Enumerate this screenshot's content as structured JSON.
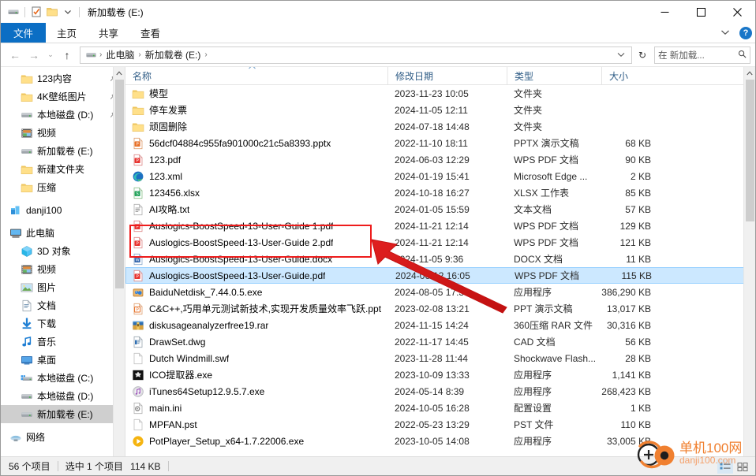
{
  "window": {
    "title": "新加载卷 (E:)",
    "quick_access": [
      {
        "name": "drive-icon",
        "glyph": "drive"
      },
      {
        "name": "properties-checkbox-icon",
        "glyph": "check"
      },
      {
        "name": "new-folder-icon",
        "glyph": "folder"
      },
      {
        "name": "customize-qat-chevron-icon",
        "glyph": "chevron-down"
      }
    ],
    "controls": {
      "minimize": "─",
      "maximize": "□",
      "close": "✕"
    }
  },
  "ribbon": {
    "tabs": [
      {
        "label": "文件",
        "active": true
      },
      {
        "label": "主页",
        "active": false
      },
      {
        "label": "共享",
        "active": false
      },
      {
        "label": "查看",
        "active": false
      }
    ],
    "collapse_chevron": "⌄",
    "help_label": "?"
  },
  "address": {
    "back": "←",
    "forward": "→",
    "recent": "⌄",
    "up": "↑",
    "crumbs": [
      "此电脑",
      "新加载卷 (E:)"
    ],
    "separator": "›",
    "refresh": "↻",
    "search_value": "在 新加载...",
    "search_placeholder": "在 新加载卷 (E:) 中搜索",
    "search_icon": "⌕"
  },
  "nav_pane": {
    "items": [
      {
        "label": "123内容",
        "icon": "folder",
        "indent": 1,
        "pinned": true,
        "selected": false
      },
      {
        "label": "4K壁纸图片",
        "icon": "folder",
        "indent": 1,
        "pinned": true,
        "selected": false
      },
      {
        "label": "本地磁盘 (D:)",
        "icon": "drive",
        "indent": 1,
        "pinned": true,
        "selected": false
      },
      {
        "label": "视频",
        "icon": "video",
        "indent": 1,
        "pinned": false,
        "selected": false
      },
      {
        "label": "新加载卷 (E:)",
        "icon": "drive",
        "indent": 1,
        "pinned": false,
        "selected": false
      },
      {
        "label": "新建文件夹",
        "icon": "folder",
        "indent": 1,
        "pinned": false,
        "selected": false
      },
      {
        "label": "压缩",
        "icon": "folder",
        "indent": 1,
        "pinned": false,
        "selected": false
      },
      {
        "label": "danji100",
        "icon": "onedrive",
        "indent": 0,
        "pinned": false,
        "selected": false,
        "gap_before": true
      },
      {
        "label": "此电脑",
        "icon": "pc",
        "indent": 0,
        "pinned": false,
        "selected": false,
        "gap_before": true
      },
      {
        "label": "3D 对象",
        "icon": "3d",
        "indent": 1,
        "pinned": false,
        "selected": false
      },
      {
        "label": "视频",
        "icon": "video",
        "indent": 1,
        "pinned": false,
        "selected": false
      },
      {
        "label": "图片",
        "icon": "pictures",
        "indent": 1,
        "pinned": false,
        "selected": false
      },
      {
        "label": "文档",
        "icon": "documents",
        "indent": 1,
        "pinned": false,
        "selected": false
      },
      {
        "label": "下载",
        "icon": "downloads",
        "indent": 1,
        "pinned": false,
        "selected": false
      },
      {
        "label": "音乐",
        "icon": "music",
        "indent": 1,
        "pinned": false,
        "selected": false
      },
      {
        "label": "桌面",
        "icon": "desktop",
        "indent": 1,
        "pinned": false,
        "selected": false
      },
      {
        "label": "本地磁盘 (C:)",
        "icon": "sysdrive",
        "indent": 1,
        "pinned": false,
        "selected": false
      },
      {
        "label": "本地磁盘 (D:)",
        "icon": "drive",
        "indent": 1,
        "pinned": false,
        "selected": false
      },
      {
        "label": "新加载卷 (E:)",
        "icon": "drive",
        "indent": 1,
        "pinned": false,
        "selected": true
      },
      {
        "label": "网络",
        "icon": "network",
        "indent": 0,
        "pinned": false,
        "selected": false,
        "gap_before": true
      }
    ]
  },
  "columns": [
    {
      "key": "name",
      "label": "名称",
      "sorted": "asc"
    },
    {
      "key": "date",
      "label": "修改日期",
      "sorted": ""
    },
    {
      "key": "type",
      "label": "类型",
      "sorted": ""
    },
    {
      "key": "size",
      "label": "大小",
      "sorted": ""
    }
  ],
  "files": [
    {
      "name": "模型",
      "date": "2023-11-23 10:05",
      "type": "文件夹",
      "size": "",
      "icon": "folder",
      "selected": false
    },
    {
      "name": "停车发票",
      "date": "2024-11-05 12:11",
      "type": "文件夹",
      "size": "",
      "icon": "folder",
      "selected": false
    },
    {
      "name": "顽固删除",
      "date": "2024-07-18 14:48",
      "type": "文件夹",
      "size": "",
      "icon": "folder",
      "selected": false
    },
    {
      "name": "56dcf04884c955fa901000c21c5a8393.pptx",
      "date": "2022-11-10 18:11",
      "type": "PPTX 演示文稿",
      "size": "68 KB",
      "icon": "pptx",
      "selected": false
    },
    {
      "name": "123.pdf",
      "date": "2024-06-03 12:29",
      "type": "WPS PDF 文档",
      "size": "90 KB",
      "icon": "pdf",
      "selected": false
    },
    {
      "name": "123.xml",
      "date": "2024-01-19 15:41",
      "type": "Microsoft Edge ...",
      "size": "2 KB",
      "icon": "edge",
      "selected": false
    },
    {
      "name": "123456.xlsx",
      "date": "2024-10-18 16:27",
      "type": "XLSX 工作表",
      "size": "85 KB",
      "icon": "xlsx",
      "selected": false
    },
    {
      "name": "AI攻略.txt",
      "date": "2024-01-05 15:59",
      "type": "文本文档",
      "size": "57 KB",
      "icon": "txt",
      "selected": false
    },
    {
      "name": "Auslogics-BoostSpeed-13-User-Guide 1.pdf",
      "date": "2024-11-21 12:14",
      "type": "WPS PDF 文档",
      "size": "129 KB",
      "icon": "pdf",
      "selected": false
    },
    {
      "name": "Auslogics-BoostSpeed-13-User-Guide 2.pdf",
      "date": "2024-11-21 12:14",
      "type": "WPS PDF 文档",
      "size": "121 KB",
      "icon": "pdf",
      "selected": false
    },
    {
      "name": "Auslogics-BoostSpeed-13-User-Guide.docx",
      "date": "2024-11-05 9:36",
      "type": "DOCX 文档",
      "size": "11 KB",
      "icon": "docx",
      "selected": false
    },
    {
      "name": "Auslogics-BoostSpeed-13-User-Guide.pdf",
      "date": "2024-06-12 16:05",
      "type": "WPS PDF 文档",
      "size": "115 KB",
      "icon": "pdf",
      "selected": true
    },
    {
      "name": "BaiduNetdisk_7.44.0.5.exe",
      "date": "2024-08-05 17:38",
      "type": "应用程序",
      "size": "386,290 KB",
      "icon": "baidu",
      "selected": false
    },
    {
      "name": "C&C++,巧用单元测试新技术,实现开发质量效率飞跃.ppt",
      "date": "2023-02-08 13:21",
      "type": "PPT 演示文稿",
      "size": "13,017 KB",
      "icon": "ppt",
      "selected": false
    },
    {
      "name": "diskusageanalyzerfree19.rar",
      "date": "2024-11-15 14:24",
      "type": "360压缩 RAR 文件",
      "size": "30,316 KB",
      "icon": "rar",
      "selected": false
    },
    {
      "name": "DrawSet.dwg",
      "date": "2022-11-17 14:45",
      "type": "CAD 文档",
      "size": "56 KB",
      "icon": "dwg",
      "selected": false
    },
    {
      "name": "Dutch Windmill.swf",
      "date": "2023-11-28 11:44",
      "type": "Shockwave Flash...",
      "size": "28 KB",
      "icon": "blank",
      "selected": false
    },
    {
      "name": "ICO提取器.exe",
      "date": "2023-10-09 13:33",
      "type": "应用程序",
      "size": "1,141 KB",
      "icon": "icoexe",
      "selected": false
    },
    {
      "name": "iTunes64Setup12.9.5.7.exe",
      "date": "2024-05-14 8:39",
      "type": "应用程序",
      "size": "268,423 KB",
      "icon": "itunes",
      "selected": false
    },
    {
      "name": "main.ini",
      "date": "2024-10-05 16:28",
      "type": "配置设置",
      "size": "1 KB",
      "icon": "ini",
      "selected": false
    },
    {
      "name": "MPFAN.pst",
      "date": "2022-05-23 13:29",
      "type": "PST 文件",
      "size": "110 KB",
      "icon": "blank",
      "selected": false
    },
    {
      "name": "PotPlayer_Setup_x64-1.7.22006.exe",
      "date": "2023-10-05 14:08",
      "type": "应用程序",
      "size": "33,005 KB",
      "icon": "potplayer",
      "selected": false
    }
  ],
  "status": {
    "item_count": "56 个项目",
    "selection": "选中 1 个项目",
    "selection_size": "114 KB",
    "view_details_icon": "details-view-icon",
    "view_large_icon": "large-icons-view-icon"
  },
  "annotations": {
    "highlight_box_color": "#ee1c1c",
    "arrow_color": "#e02020"
  },
  "watermark": {
    "cn": "单机100网",
    "en": "danji100.com",
    "color": "#f08030"
  }
}
